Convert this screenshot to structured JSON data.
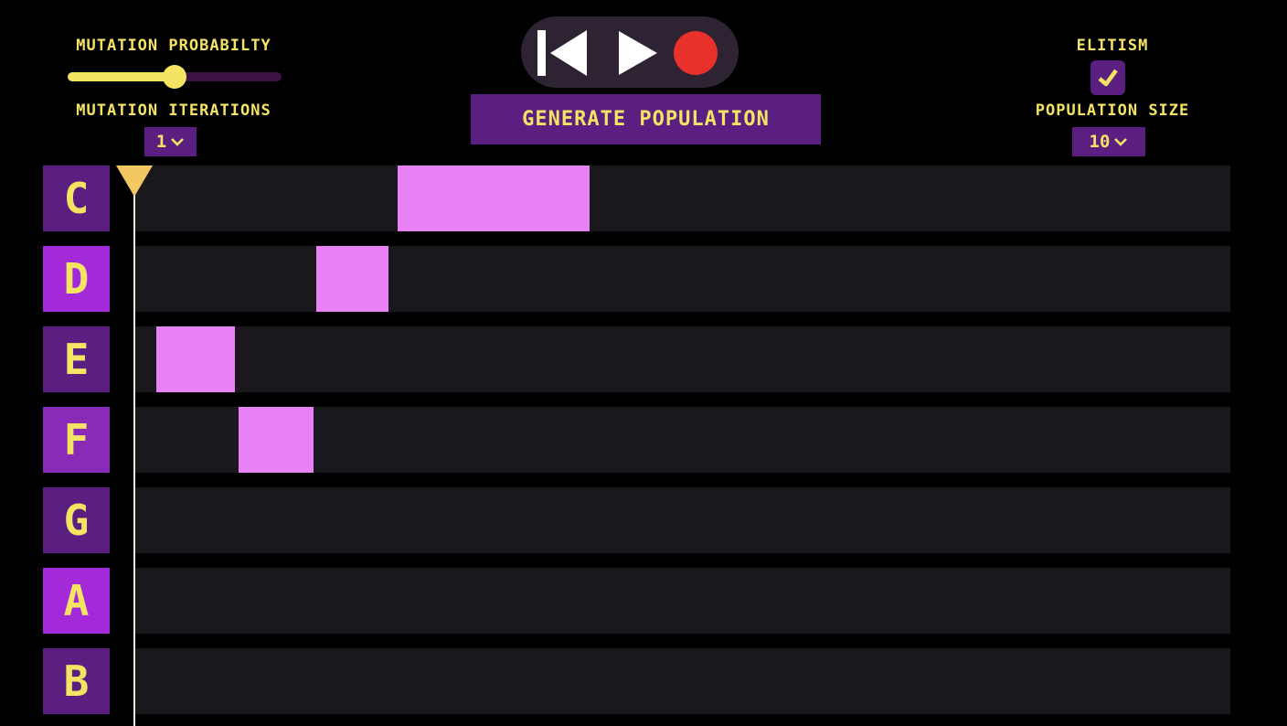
{
  "controls": {
    "mutation_probability_label": "MUTATION PROBABILTY",
    "mutation_probability_value": 0.5,
    "mutation_iterations_label": "MUTATION ITERATIONS",
    "mutation_iterations_value": "1",
    "generate_button_label": "GENERATE POPULATION",
    "elitism_label": "ELITISM",
    "elitism_checked": true,
    "population_size_label": "POPULATION SIZE",
    "population_size_value": "10"
  },
  "transport": {
    "buttons": [
      "skip-back-icon",
      "play-icon",
      "record-icon"
    ],
    "record_color": "#e8312a"
  },
  "tracks": [
    {
      "key": "C",
      "key_color": "#5a1f80",
      "notes": [
        {
          "start": 0.24,
          "length": 0.175
        }
      ]
    },
    {
      "key": "D",
      "key_color": "#a42ad9",
      "notes": [
        {
          "start": 0.166,
          "length": 0.066
        }
      ]
    },
    {
      "key": "E",
      "key_color": "#5a1f80",
      "notes": [
        {
          "start": 0.02,
          "length": 0.072
        }
      ]
    },
    {
      "key": "F",
      "key_color": "#8a2ab8",
      "notes": [
        {
          "start": 0.095,
          "length": 0.068
        }
      ]
    },
    {
      "key": "G",
      "key_color": "#5a1f80",
      "notes": []
    },
    {
      "key": "A",
      "key_color": "#a42ad9",
      "notes": []
    },
    {
      "key": "B",
      "key_color": "#5a1f80",
      "notes": []
    }
  ],
  "colors": {
    "accent_yellow": "#f5e463",
    "purple": "#5a1f80",
    "note_pink": "#e781f5",
    "lane_bg": "#1b181d"
  }
}
